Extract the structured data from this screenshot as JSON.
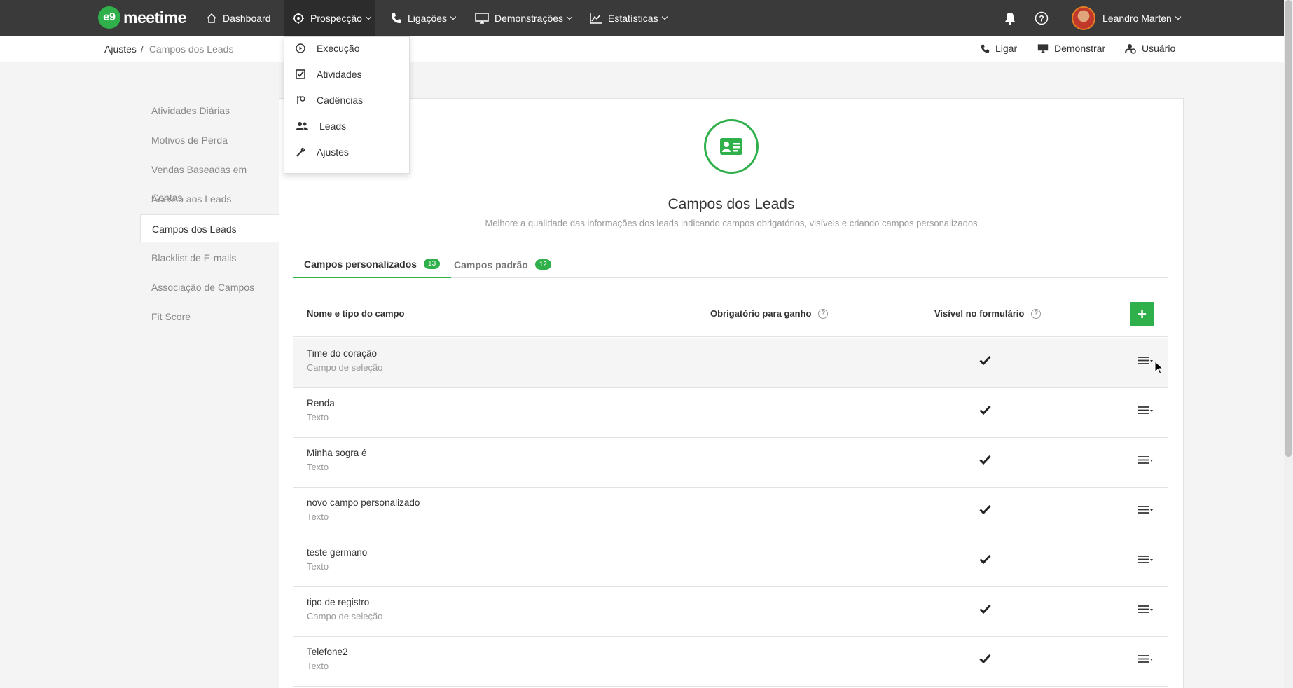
{
  "nav": {
    "logo_mark": "e9",
    "logo_text": "meetime",
    "items": [
      {
        "label": "Dashboard"
      },
      {
        "label": "Prospecção"
      },
      {
        "label": "Ligações"
      },
      {
        "label": "Demonstrações"
      },
      {
        "label": "Estatísticas"
      }
    ],
    "user_name": "Leandro Marten"
  },
  "breadcrumb": {
    "root": "Ajustes",
    "sep": "/",
    "current": "Campos dos Leads"
  },
  "quick_actions": [
    {
      "label": "Ligar"
    },
    {
      "label": "Demonstrar"
    },
    {
      "label": "Usuário"
    }
  ],
  "dropdown": {
    "items": [
      {
        "label": "Execução",
        "icon": "play-circle-icon"
      },
      {
        "label": "Atividades",
        "icon": "checkbox-icon"
      },
      {
        "label": "Cadências",
        "icon": "cadence-icon"
      },
      {
        "label": "Leads",
        "icon": "users-icon"
      },
      {
        "label": "Ajustes",
        "icon": "wrench-icon"
      }
    ]
  },
  "sidebar": {
    "items": [
      {
        "label": "Atividades Diárias"
      },
      {
        "label": "Motivos de Perda"
      },
      {
        "label": "Vendas Baseadas em Contas"
      },
      {
        "label": "Acesso aos Leads"
      },
      {
        "label": "Campos dos Leads",
        "active": true
      },
      {
        "label": "Blacklist de E-mails"
      },
      {
        "label": "Associação de Campos"
      },
      {
        "label": "Fit Score"
      }
    ]
  },
  "main": {
    "title": "Campos dos Leads",
    "subtitle": "Melhore a qualidade das informações dos leads indicando campos obrigatórios, visíveis e criando campos personalizados",
    "tabs": [
      {
        "label": "Campos personalizados",
        "count": "13"
      },
      {
        "label": "Campos padrão",
        "count": "12"
      }
    ],
    "table": {
      "headers": {
        "name": "Nome e tipo do campo",
        "required": "Obrigatório para ganho",
        "visible": "Visível no formulário",
        "help": "?",
        "add": "+"
      },
      "rows": [
        {
          "name": "Time do coração",
          "type": "Campo de seleção",
          "visible": true
        },
        {
          "name": "Renda",
          "type": "Texto",
          "visible": true
        },
        {
          "name": "Minha sogra é",
          "type": "Texto",
          "visible": true
        },
        {
          "name": "novo campo personalizado",
          "type": "Texto",
          "visible": true
        },
        {
          "name": "teste germano",
          "type": "Texto",
          "visible": true
        },
        {
          "name": "tipo de registro",
          "type": "Campo de seleção",
          "visible": true
        },
        {
          "name": "Telefone2",
          "type": "Texto",
          "visible": true
        }
      ]
    }
  },
  "colors": {
    "accent": "#2fb04a",
    "nav_bg": "#3a3a3a"
  }
}
